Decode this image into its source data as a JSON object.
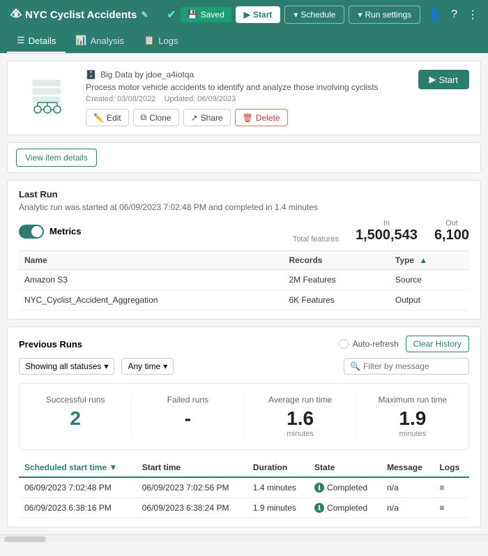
{
  "topbar": {
    "title": "NYC Cyclist Accidents",
    "edit_tooltip": "Edit",
    "status": "Saved",
    "btn_start": "Start",
    "btn_schedule": "Schedule",
    "btn_run_settings": "Run settings"
  },
  "tabs": [
    {
      "id": "details",
      "label": "Details",
      "active": true
    },
    {
      "id": "analysis",
      "label": "Analysis",
      "active": false
    },
    {
      "id": "logs",
      "label": "Logs",
      "active": false
    }
  ],
  "project": {
    "owner_icon": "data-icon",
    "owner": "Big Data by jdoe_a4iotqa",
    "description": "Process motor vehicle accidents to identify and analyze those involving cyclists",
    "created": "Created: 03/08/2022",
    "updated": "Updated: 06/09/2023",
    "btn_start": "Start",
    "btn_edit": "Edit",
    "btn_clone": "Clone",
    "btn_share": "Share",
    "btn_delete": "Delete"
  },
  "view_details": {
    "btn_label": "View item details"
  },
  "last_run": {
    "title": "Last Run",
    "subtitle": "Analytic run was started at 06/09/2023 7:02:48 PM and completed in 1.4 minutes",
    "metrics_label": "Metrics",
    "total_features_label": "Total features",
    "in_label": "In",
    "out_label": "Out",
    "total_features": "1,500,543",
    "in_val": "1,500,543",
    "out_val": "6,100",
    "table": {
      "headers": [
        {
          "key": "name",
          "label": "Name",
          "sortable": false
        },
        {
          "key": "records",
          "label": "Records",
          "sortable": false
        },
        {
          "key": "type",
          "label": "Type",
          "sortable": true
        }
      ],
      "rows": [
        {
          "name": "Amazon S3",
          "records": "2M Features",
          "type": "Source"
        },
        {
          "name": "NYC_Cyclist_Accident_Aggregation",
          "records": "6K Features",
          "type": "Output"
        }
      ]
    }
  },
  "previous_runs": {
    "title": "Previous Runs",
    "auto_refresh_label": "Auto-refresh",
    "btn_clear_history": "Clear History",
    "filter_status_label": "Showing all statuses",
    "filter_time_label": "Any time",
    "filter_placeholder": "Filter by message",
    "stats": {
      "successful_runs_label": "Successful runs",
      "successful_runs_val": "2",
      "failed_runs_label": "Failed runs",
      "failed_runs_val": "-",
      "avg_run_time_label": "Average run time",
      "avg_run_time_val": "1.6",
      "avg_run_time_unit": "minutes",
      "max_run_time_label": "Maximum run time",
      "max_run_time_val": "1.9",
      "max_run_time_unit": "minutes"
    },
    "table": {
      "headers": [
        {
          "key": "scheduled_start",
          "label": "Scheduled start time",
          "active": true
        },
        {
          "key": "start_time",
          "label": "Start time"
        },
        {
          "key": "duration",
          "label": "Duration"
        },
        {
          "key": "state",
          "label": "State"
        },
        {
          "key": "message",
          "label": "Message"
        },
        {
          "key": "logs",
          "label": "Logs"
        }
      ],
      "rows": [
        {
          "scheduled_start": "06/09/2023 7:02:48 PM",
          "start_time": "06/09/2023 7:02:56 PM",
          "duration": "1.4 minutes",
          "state": "Completed",
          "message": "n/a",
          "logs": "≡"
        },
        {
          "scheduled_start": "06/09/2023 6:38:16 PM",
          "start_time": "06/09/2023 6:38:24 PM",
          "duration": "1.9 minutes",
          "state": "Completed",
          "message": "n/a",
          "logs": "≡"
        }
      ]
    }
  },
  "colors": {
    "primary": "#2d7d6f",
    "danger": "#c0392b"
  }
}
